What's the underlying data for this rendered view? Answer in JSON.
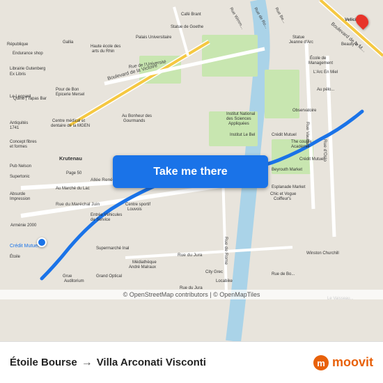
{
  "map": {
    "attribution": "© OpenStreetMap contributors | © OpenMapTiles"
  },
  "button": {
    "label": "Take me there"
  },
  "footer": {
    "origin": "Étoile Bourse",
    "arrow": "→",
    "destination": "Villa Arconati Visconti",
    "logo": "moovit"
  }
}
